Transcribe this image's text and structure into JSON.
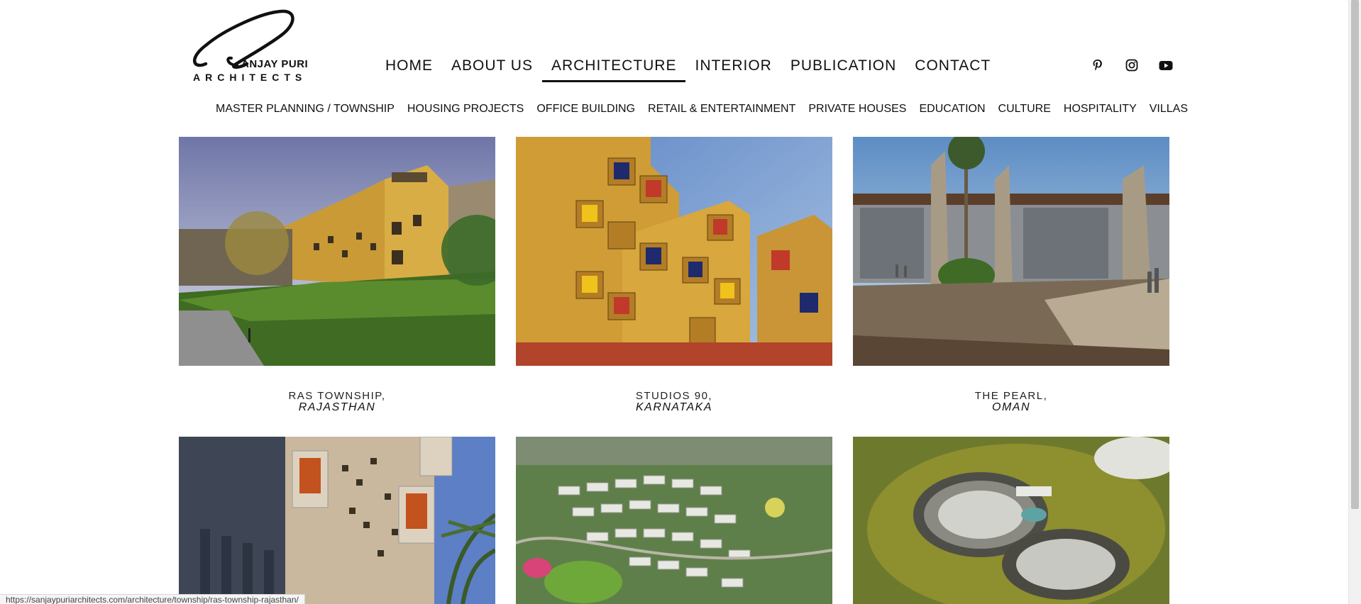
{
  "logo": {
    "line1": "ANJAY PURI",
    "line2": "ARCHITECTS"
  },
  "main_nav": [
    {
      "label": "HOME",
      "active": false
    },
    {
      "label": "ABOUT US",
      "active": false
    },
    {
      "label": "ARCHITECTURE",
      "active": true
    },
    {
      "label": "INTERIOR",
      "active": false
    },
    {
      "label": "PUBLICATION",
      "active": false
    },
    {
      "label": "CONTACT",
      "active": false
    }
  ],
  "social": [
    {
      "icon": "pinterest-icon"
    },
    {
      "icon": "instagram-icon"
    },
    {
      "icon": "youtube-icon"
    }
  ],
  "sub_nav": [
    {
      "label": "MASTER PLANNING / TOWNSHIP"
    },
    {
      "label": "HOUSING PROJECTS"
    },
    {
      "label": "OFFICE BUILDING"
    },
    {
      "label": "RETAIL & ENTERTAINMENT"
    },
    {
      "label": "PRIVATE HOUSES"
    },
    {
      "label": "EDUCATION"
    },
    {
      "label": "CULTURE"
    },
    {
      "label": "HOSPITALITY"
    },
    {
      "label": "VILLAS"
    }
  ],
  "projects": [
    {
      "name": "RAS TOWNSHIP,",
      "location": "RAJASTHAN"
    },
    {
      "name": "STUDIOS 90,",
      "location": "KARNATAKA"
    },
    {
      "name": "THE PEARL,",
      "location": "OMAN"
    },
    {
      "name": "",
      "location": ""
    },
    {
      "name": "",
      "location": ""
    },
    {
      "name": "",
      "location": ""
    }
  ],
  "status_bar": {
    "url": "https://sanjaypuriarchitects.com/architecture/township/ras-township-rajasthan/"
  },
  "colors": {
    "text": "#111111",
    "background": "#ffffff",
    "building_yellow": "#d6a638",
    "sky_blue": "#7fa2cf"
  }
}
